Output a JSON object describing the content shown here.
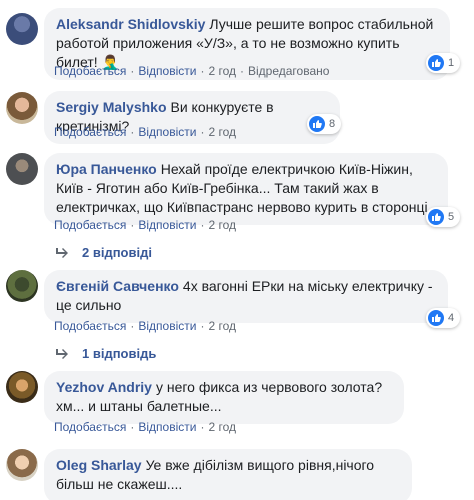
{
  "comments": [
    {
      "author": "Aleksandr Shidlovskiy",
      "text": "Лучше решите вопрос стабильной работой приложения «У/З», а то не возможно купить билет! 🤦‍♂️",
      "like_label": "Подобається",
      "reply_label": "Відповісти",
      "time": "2 год",
      "edited": "Відредаговано",
      "reaction_count": "1"
    },
    {
      "author": "Sergiy Malyshko",
      "text": "Ви конкуруєте в кретинізмі?",
      "like_label": "Подобається",
      "reply_label": "Відповісти",
      "time": "2 год",
      "reaction_count": "8"
    },
    {
      "author": "Юра Панченко",
      "text": "Нехай проїде електричкою Київ-Ніжин, Київ - Яготин або Київ-Гребінка... Там такий жах в електричках, що Київпастранс нервово курить в сторонці",
      "like_label": "Подобається",
      "reply_label": "Відповісти",
      "time": "2 год",
      "reaction_count": "5",
      "replies": "2 відповіді"
    },
    {
      "author": "Євгеній Савченко",
      "text": "4х вагонні ЕРки на міську електричку - це сильно",
      "like_label": "Подобається",
      "reply_label": "Відповісти",
      "time": "2 год",
      "reaction_count": "4",
      "replies": "1 відповідь"
    },
    {
      "author": "Yezhov Andriy",
      "text": "у него фикса из червового золота? хм... и штаны балетные...",
      "like_label": "Подобається",
      "reply_label": "Відповісти",
      "time": "2 год"
    },
    {
      "author": "Oleg Sharlay",
      "text": "Уе вже дібілізм вищого рівня,нічого більш не скажеш...."
    }
  ],
  "colors": {
    "link": "#385898",
    "bubble": "#f2f3f5",
    "like": "#2078f4"
  },
  "icons": {
    "reaction": "like-icon",
    "replies": "reply-arrow-icon"
  }
}
